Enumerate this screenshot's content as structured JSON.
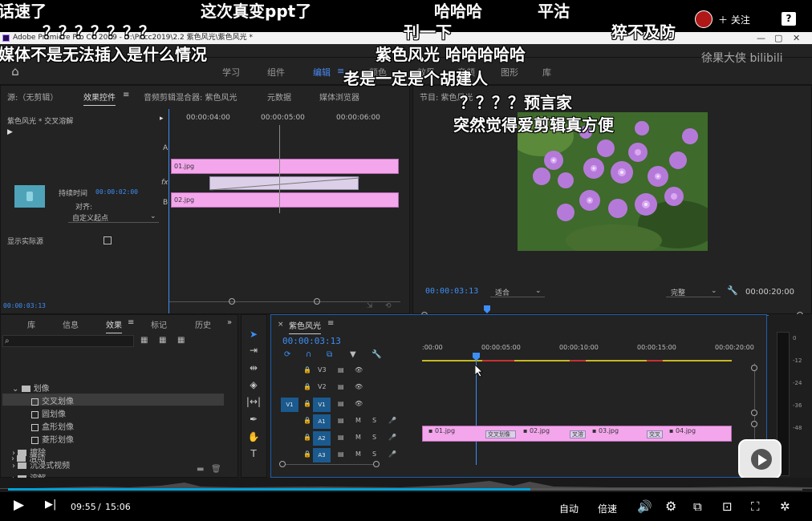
{
  "app": {
    "title": "Adobe Premiere Pro CC 2019 - D:\\Pr cc2019\\2.2 紫色风光\\紫色风光 *"
  },
  "window_controls": [
    "—",
    "▢",
    "✕"
  ],
  "workspace_tabs": [
    "学习",
    "组件",
    "编辑",
    "≡",
    "颜色",
    "效果",
    "音频",
    "图形",
    "库"
  ],
  "source_panel": {
    "tabs": [
      "源:（无剪辑）",
      "效果控件",
      "音频剪辑混合器: 紫色风光",
      "元数据",
      "媒体浏览器"
    ],
    "sequence_label": "紫色风光 * 交叉溶解",
    "ruler": [
      "00:00:04:00",
      "00:00:05:00",
      "00:00:06:00"
    ],
    "clip_a": "01.jpg",
    "clip_b": "02.jpg",
    "track_a": "A",
    "track_b": "B",
    "fx": "fx",
    "duration_label": "持续时间",
    "duration_value": "00:00:02:00",
    "align_label": "对齐:",
    "align_value": "自定义起点",
    "show_source": "显示实际源",
    "timecode": "00:00:03:13"
  },
  "program_panel": {
    "title": "节目: 紫色风光",
    "timecode": "00:00:03:13",
    "fit": "适合",
    "quality": "完整",
    "duration": "00:00:20:00"
  },
  "effects_panel": {
    "tabs": [
      "库",
      "信息",
      "效果",
      "标记",
      "历史"
    ],
    "tree": [
      {
        "label": "划像",
        "type": "folder",
        "open": true
      },
      {
        "label": "交叉划像",
        "type": "effect",
        "selected": true
      },
      {
        "label": "圆划像",
        "type": "effect"
      },
      {
        "label": "盒形划像",
        "type": "effect"
      },
      {
        "label": "菱形划像",
        "type": "effect"
      },
      {
        "label": "擦除",
        "type": "folder"
      },
      {
        "label": "沉浸式视频",
        "type": "folder"
      },
      {
        "label": "溶解",
        "type": "folder"
      },
      {
        "label": "滑动",
        "type": "folder"
      }
    ]
  },
  "timeline": {
    "sequence_name": "紫色风光",
    "timecode": "00:00:03:13",
    "ruler": [
      ":00:00",
      "00:00:05:00",
      "00:00:10:00",
      "00:00:15:00",
      "00:00:20:00"
    ],
    "tracks": [
      {
        "name": "V3",
        "type": "video"
      },
      {
        "name": "V2",
        "type": "video"
      },
      {
        "name": "V1",
        "type": "video",
        "source": "V1"
      },
      {
        "name": "A1",
        "type": "audio"
      },
      {
        "name": "A2",
        "type": "audio"
      },
      {
        "name": "A3",
        "type": "audio"
      }
    ],
    "clips": [
      {
        "name": "01.jpg"
      },
      {
        "name": "交叉划像"
      },
      {
        "name": "02.jpg"
      },
      {
        "name": "叉溶"
      },
      {
        "name": "03.jpg"
      },
      {
        "name": "交叉"
      },
      {
        "name": "04.jpg"
      }
    ],
    "track_toggles": [
      "M",
      "S"
    ]
  },
  "audio_meter": {
    "scale": [
      "0",
      "-12",
      "-24",
      "-36",
      "-48"
    ]
  },
  "danmaku": [
    "话速了",
    "这次真变ppt了",
    "哈哈哈",
    "平沽",
    "？？？？？？？",
    "刊一下",
    "猝不及防",
    "媒体不是无法插入是什么情况",
    "紫色风光 哈哈哈哈哈",
    "老是一定是个胡建人",
    "？？？？预言家",
    "突然觉得爱剪辑真方便"
  ],
  "uploader": {
    "follow_label": "关注",
    "watermark": "徐果大侠"
  },
  "player": {
    "current_time": "09:55",
    "separator": "/",
    "total_time": "15:06",
    "quality_label": "自动",
    "speed_label": "倍速",
    "progress": 0.658
  },
  "colors": {
    "accent": "#3d8ef5",
    "clip": "#f4a6ec",
    "player_progress": "#00a1d6"
  }
}
